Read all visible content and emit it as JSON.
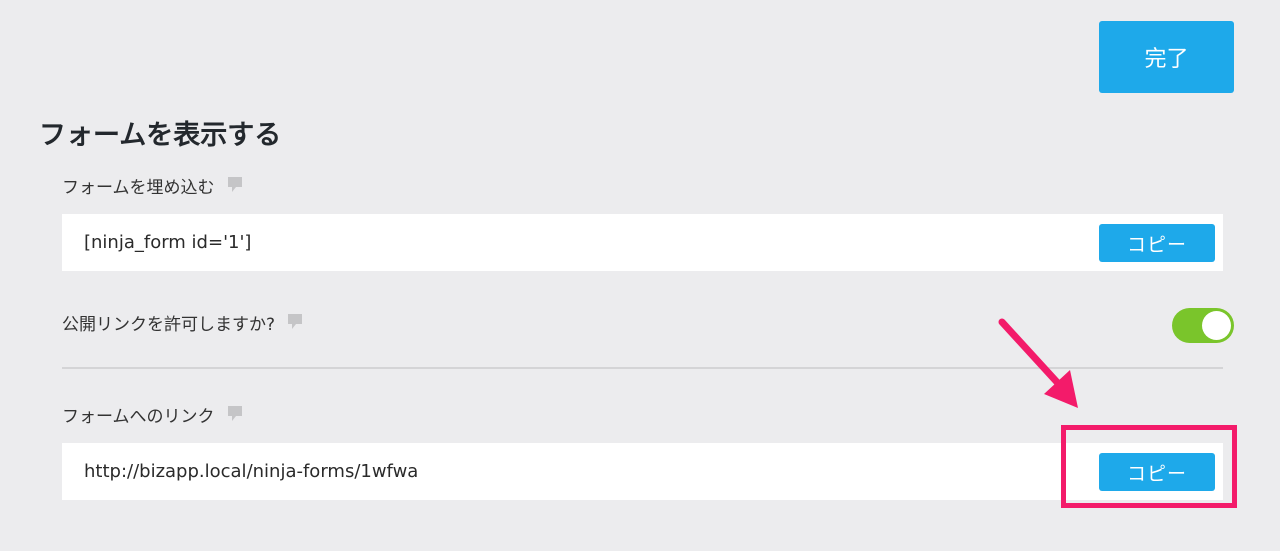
{
  "header": {
    "done_label": "完了"
  },
  "title": "フォームを表示する",
  "embed": {
    "label": "フォームを埋め込む",
    "value": "[ninja_form id='1']",
    "copy_label": "コピー"
  },
  "public_link": {
    "label": "公開リンクを許可しますか?",
    "enabled": true
  },
  "form_link": {
    "label": "フォームへのリンク",
    "value": "http://bizapp.local/ninja-forms/1wfwa",
    "copy_label": "コピー"
  },
  "icons": {
    "help": "help-comment-icon",
    "annotation_arrow": "pink-arrow-icon"
  },
  "colors": {
    "accent": "#1ea9ea",
    "toggle_on": "#7ac52b",
    "annotation": "#f31b6a"
  }
}
